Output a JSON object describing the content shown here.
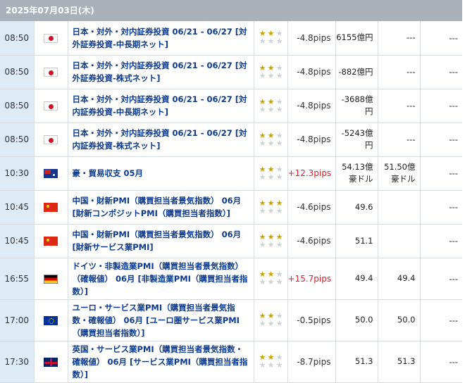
{
  "header": {
    "date": "2025年07月03日(木)"
  },
  "rows": [
    {
      "time": "08:50",
      "flag": "jp",
      "name": "日本・対外・対内証券投資 06/21 - 06/27 [対外証券投資-中長期ネット]",
      "stars": 2,
      "pips": "-4.8pips",
      "pips_dir": "neg",
      "actual": "6155億円",
      "forecast": "---",
      "previous": "---"
    },
    {
      "time": "08:50",
      "flag": "jp",
      "name": "日本・対外・対内証券投資 06/21 - 06/27 [対外証券投資-株式ネット]",
      "stars": 2,
      "pips": "-4.8pips",
      "pips_dir": "neg",
      "actual": "-882億円",
      "forecast": "---",
      "previous": "---"
    },
    {
      "time": "08:50",
      "flag": "jp",
      "name": "日本・対外・対内証券投資 06/21 - 06/27 [対内証券投資-中長期ネット]",
      "stars": 2,
      "pips": "-4.8pips",
      "pips_dir": "neg",
      "actual": "-3688億円",
      "forecast": "---",
      "previous": "---"
    },
    {
      "time": "08:50",
      "flag": "jp",
      "name": "日本・対外・対内証券投資 06/21 - 06/27 [対内証券投資-株式ネット]",
      "stars": 2,
      "pips": "-4.8pips",
      "pips_dir": "neg",
      "actual": "-5243億円",
      "forecast": "---",
      "previous": "---"
    },
    {
      "time": "10:30",
      "flag": "au",
      "name": "豪・貿易収支 05月",
      "stars": 2,
      "pips": "+12.3pips",
      "pips_dir": "pos",
      "actual": "54.13億豪ドル",
      "forecast": "51.50億豪ドル",
      "previous": "---"
    },
    {
      "time": "10:45",
      "flag": "cn",
      "name": "中国・財新PMI（購買担当者景気指数） 06月 [財新コンポジットPMI（購買担当者指数）]",
      "stars": 3,
      "pips": "-4.6pips",
      "pips_dir": "neg",
      "actual": "49.6",
      "forecast": "",
      "previous": "---"
    },
    {
      "time": "10:45",
      "flag": "cn",
      "name": "中国・財新PMI（購買担当者景気指数） 06月 [財新サービス業PMI]",
      "stars": 3,
      "pips": "-4.6pips",
      "pips_dir": "neg",
      "actual": "51.1",
      "forecast": "",
      "previous": "---"
    },
    {
      "time": "16:55",
      "flag": "de",
      "name": "ドイツ・非製造業PMI（購買担当者景気指数）（確報値） 06月 [非製造業PMI（購買担当者指数）]",
      "stars": 2,
      "pips": "+15.7pips",
      "pips_dir": "pos",
      "actual": "49.4",
      "forecast": "49.4",
      "previous": "---"
    },
    {
      "time": "17:00",
      "flag": "eu",
      "name": "ユーロ・サービス業PMI（購買担当者景気指数・確報値） 06月 [ユーロ圏サービス業PMI（購買担当者指数）]",
      "stars": 2,
      "pips": "-0.5pips",
      "pips_dir": "neg",
      "actual": "50.0",
      "forecast": "50.0",
      "previous": "---"
    },
    {
      "time": "17:30",
      "flag": "gb",
      "name": "英国・サービス業PMI（購買担当者景気指数・確報値） 06月 [サービス業PMI（購買担当者指数）]",
      "stars": 2,
      "pips": "-8.7pips",
      "pips_dir": "neg",
      "actual": "51.3",
      "forecast": "51.3",
      "previous": "---"
    }
  ],
  "colors": {
    "header_bg": "#a9b2ba",
    "time_bg": "#dcebf6",
    "link": "#0b3a8f",
    "positive": "#e0222c",
    "star_on": "#c9a400",
    "star_off": "#cdd2d6"
  },
  "icons": {
    "star": "star-icon"
  }
}
